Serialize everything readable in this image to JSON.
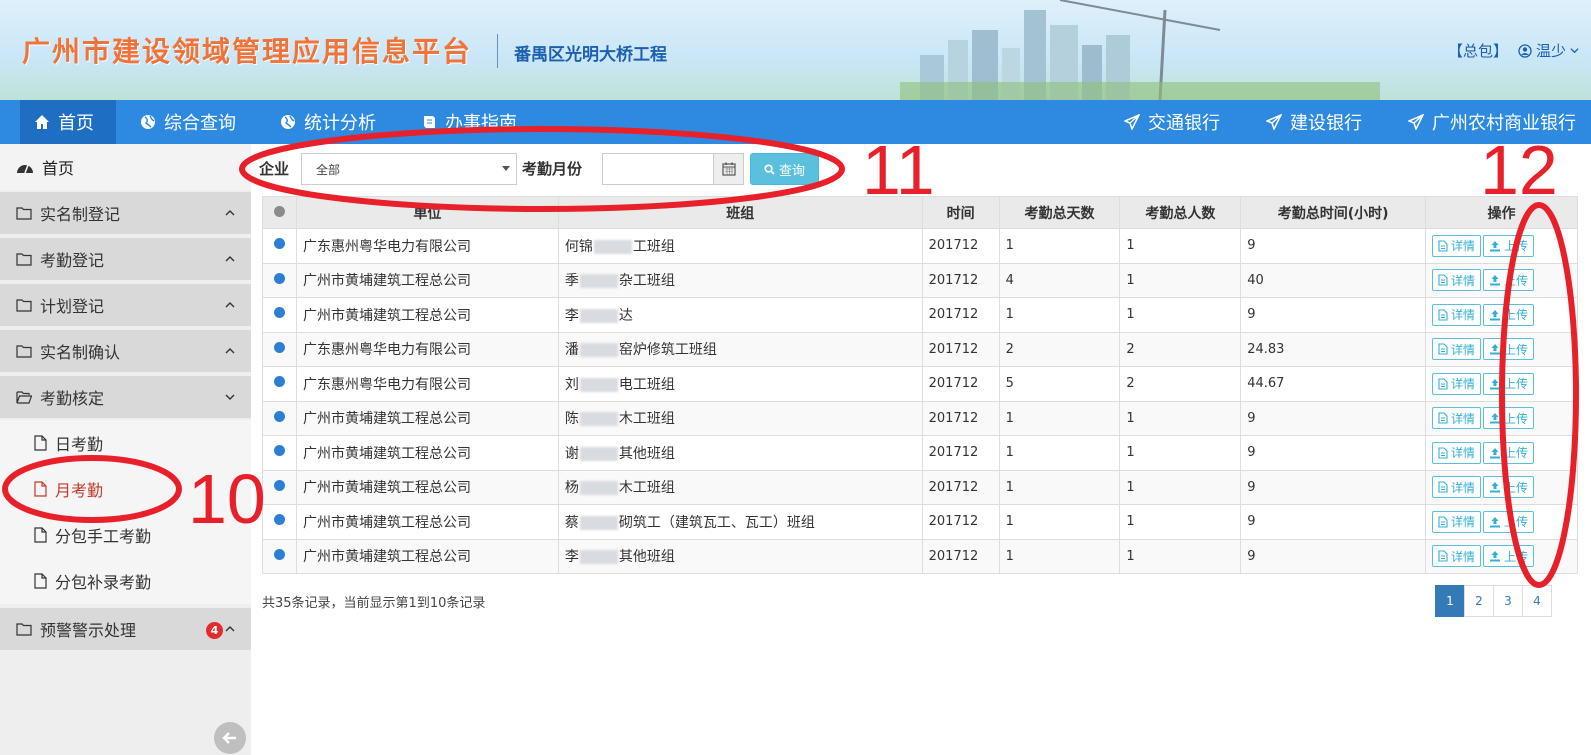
{
  "header": {
    "platform_title": "广州市建设领域管理应用信息平台",
    "project_name": "番禺区光明大桥工程",
    "package_link": "【总包】",
    "user_name": "温少"
  },
  "nav": {
    "items": [
      {
        "label": "首页",
        "icon": "home-icon"
      },
      {
        "label": "综合查询",
        "icon": "globe-icon"
      },
      {
        "label": "统计分析",
        "icon": "globe-icon"
      },
      {
        "label": "办事指南",
        "icon": "book-icon"
      }
    ],
    "banks": [
      "交通银行",
      "建设银行",
      "广州农村商业银行"
    ]
  },
  "sidebar": {
    "home": "首页",
    "groups": [
      "实名制登记",
      "考勤登记",
      "计划登记",
      "实名制确认",
      "考勤核定"
    ],
    "sub_items": [
      "日考勤",
      "月考勤",
      "分包手工考勤",
      "分包补录考勤"
    ],
    "alert_group": "预警警示处理",
    "alert_count": "4"
  },
  "filter": {
    "company_label": "企业",
    "company_value": "全部",
    "month_label": "考勤月份",
    "month_value": "",
    "query_label": "查询"
  },
  "table": {
    "headers": [
      "单位",
      "班组",
      "时间",
      "考勤总天数",
      "考勤总人数",
      "考勤总时间(小时)",
      "操作"
    ],
    "detail_label": "详情",
    "upload_label": "上传",
    "rows": [
      {
        "unit": "广东惠州粤华电力有限公司",
        "team_a": "何锦",
        "team_b": "工班组",
        "time": "201712",
        "days": "1",
        "people": "1",
        "hours": "9"
      },
      {
        "unit": "广州市黄埔建筑工程总公司",
        "team_a": "季",
        "team_b": "杂工班组",
        "time": "201712",
        "days": "4",
        "people": "1",
        "hours": "40"
      },
      {
        "unit": "广州市黄埔建筑工程总公司",
        "team_a": "李",
        "team_b": "达",
        "time": "201712",
        "days": "1",
        "people": "1",
        "hours": "9"
      },
      {
        "unit": "广东惠州粤华电力有限公司",
        "team_a": "潘",
        "team_b": "窑炉修筑工班组",
        "time": "201712",
        "days": "2",
        "people": "2",
        "hours": "24.83"
      },
      {
        "unit": "广东惠州粤华电力有限公司",
        "team_a": "刘",
        "team_b": "电工班组",
        "time": "201712",
        "days": "5",
        "people": "2",
        "hours": "44.67"
      },
      {
        "unit": "广州市黄埔建筑工程总公司",
        "team_a": "陈",
        "team_b": "木工班组",
        "time": "201712",
        "days": "1",
        "people": "1",
        "hours": "9"
      },
      {
        "unit": "广州市黄埔建筑工程总公司",
        "team_a": "谢",
        "team_b": "其他班组",
        "time": "201712",
        "days": "1",
        "people": "1",
        "hours": "9"
      },
      {
        "unit": "广州市黄埔建筑工程总公司",
        "team_a": "杨",
        "team_b": "木工班组",
        "time": "201712",
        "days": "1",
        "people": "1",
        "hours": "9"
      },
      {
        "unit": "广州市黄埔建筑工程总公司",
        "team_a": "蔡",
        "team_b": "砌筑工（建筑瓦工、瓦工）班组",
        "time": "201712",
        "days": "1",
        "people": "1",
        "hours": "9"
      },
      {
        "unit": "广州市黄埔建筑工程总公司",
        "team_a": "李",
        "team_b": "其他班组",
        "time": "201712",
        "days": "1",
        "people": "1",
        "hours": "9"
      }
    ]
  },
  "footer": {
    "record_info": "共35条记录，当前显示第1到10条记录",
    "pages": [
      "1",
      "2",
      "3",
      "4"
    ]
  },
  "annotations": {
    "n10": "10",
    "n11": "11",
    "n12": "12",
    "color": "#e8202a"
  }
}
